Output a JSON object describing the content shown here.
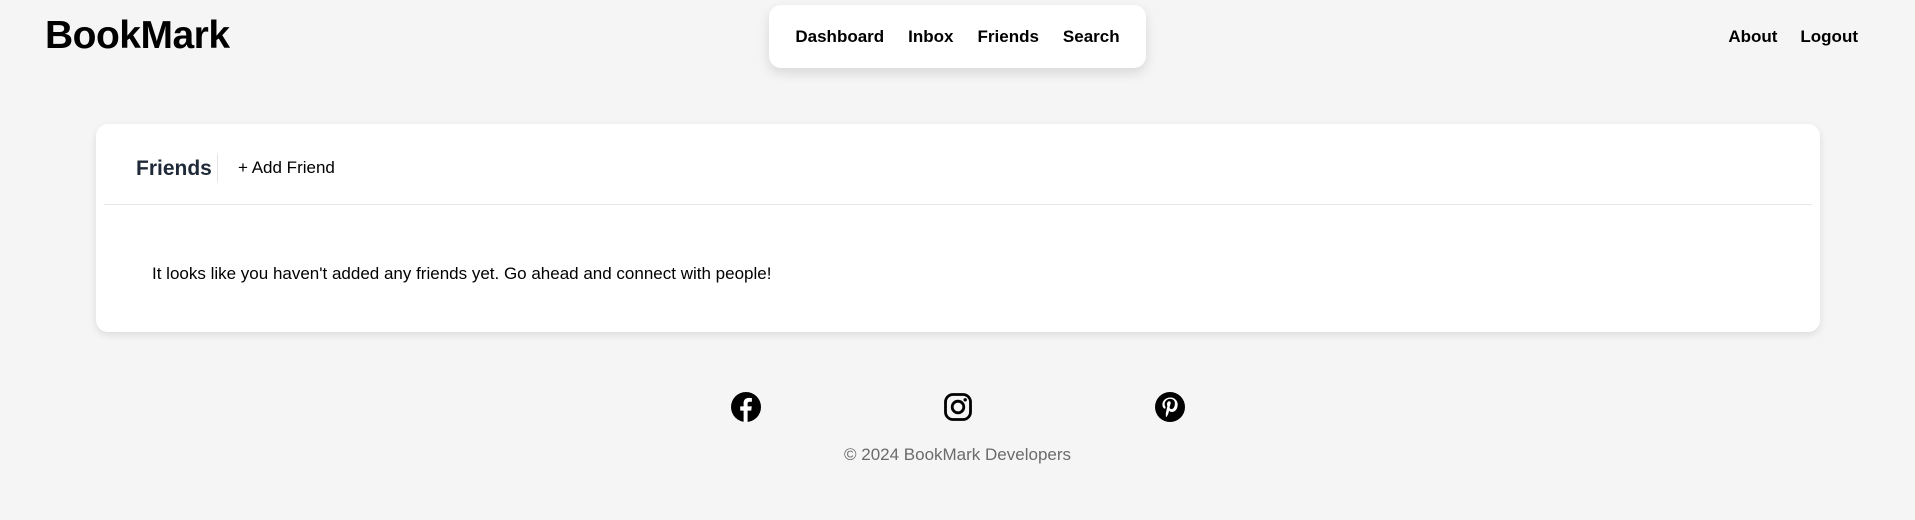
{
  "header": {
    "logo": "BookMark",
    "main_nav": [
      {
        "label": "Dashboard"
      },
      {
        "label": "Inbox"
      },
      {
        "label": "Friends"
      },
      {
        "label": "Search"
      }
    ],
    "right_nav": [
      {
        "label": "About"
      },
      {
        "label": "Logout"
      }
    ]
  },
  "friends_card": {
    "title": "Friends",
    "add_button": "+ Add Friend",
    "empty_message": "It looks like you haven't added any friends yet. Go ahead and connect with people!"
  },
  "footer": {
    "social_icons": [
      "facebook-icon",
      "instagram-icon",
      "pinterest-icon"
    ],
    "copyright": "© 2024 BookMark Developers"
  }
}
